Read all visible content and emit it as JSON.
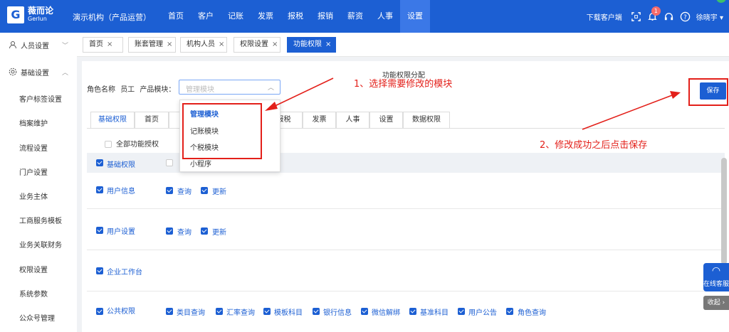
{
  "app": {
    "logo_main": "薇而论",
    "logo_sub": "Gerlun",
    "org": "演示机构（产品运营）",
    "download": "下载客户端",
    "user": "徐晓宇",
    "notify_count": "1"
  },
  "nav": [
    "首页",
    "客户",
    "记账",
    "发票",
    "报税",
    "报销",
    "薪资",
    "人事",
    "设置"
  ],
  "sidebar": {
    "group1": "人员设置",
    "group2": "基础设置",
    "items": [
      "客户标签设置",
      "档案维护",
      "流程设置",
      "门户设置",
      "业务主体",
      "工商服务模板",
      "业务关联财务",
      "权限设置",
      "系统参数",
      "公众号管理"
    ]
  },
  "tabs": [
    "首页",
    "账套管理",
    "机构人员",
    "权限设置",
    "功能权限"
  ],
  "page": {
    "title": "功能权限分配",
    "role_label": "角色名称",
    "role_value": "员工",
    "module_label": "产品模块：",
    "module_placeholder": "管理模块",
    "save": "保存",
    "all_auth": "全部功能授权",
    "basic": "基础权限"
  },
  "perm_tabs": [
    "基础权限",
    "首页",
    "",
    "",
    "报税",
    "发票",
    "人事",
    "设置",
    "数据权限"
  ],
  "dropdown": [
    "管理模块",
    "记账模块",
    "个税模块",
    "小程序"
  ],
  "permissions": [
    {
      "label": "用户信息",
      "items": [
        "查询",
        "更新"
      ]
    },
    {
      "label": "用户设置",
      "items": [
        "查询",
        "更新"
      ]
    },
    {
      "label": "企业工作台",
      "items": []
    },
    {
      "label": "公共权限",
      "items": [
        "类目查询",
        "汇率查询",
        "模板科目",
        "银行信息",
        "微信解绑",
        "基准科目",
        "用户公告",
        "角色查询"
      ]
    }
  ],
  "annotations": {
    "a1": "1、选择需要修改的模块",
    "a2": "2、修改成功之后点击保存"
  },
  "service": {
    "online": "在线客服",
    "collapse": "收起"
  },
  "colors": {
    "primary": "#1c5fd3",
    "annotation": "#e3201a"
  }
}
